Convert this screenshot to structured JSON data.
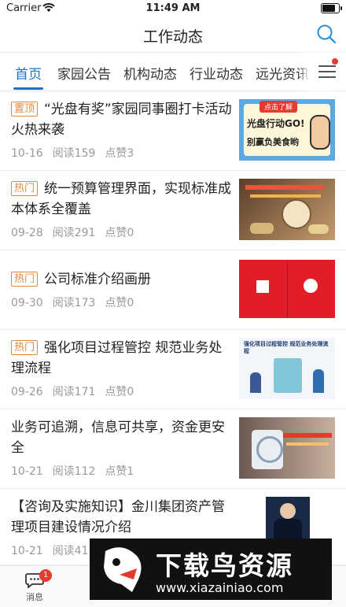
{
  "status_bar": {
    "carrier": "Carrier",
    "time": "11:49 AM",
    "battery_level": 0.9
  },
  "header": {
    "title": "工作动态"
  },
  "tabs": [
    {
      "label": "首页",
      "active": true
    },
    {
      "label": "家园公告",
      "active": false
    },
    {
      "label": "机构动态",
      "active": false
    },
    {
      "label": "行业动态",
      "active": false
    },
    {
      "label": "远光资讯",
      "active": false
    }
  ],
  "news": [
    {
      "badge": "置顶",
      "title": "“光盘有奖”家园同事圈打卡活动火热来袭",
      "date": "10-16",
      "reads": "阅读159",
      "likes": "点赞3",
      "thumb_text_1": "点击了解",
      "thumb_text_2": "光盘行动GO!",
      "thumb_text_3": "别赢负美食哟"
    },
    {
      "badge": "热门",
      "title": "统一预算管理界面，实现标准成本体系全覆盖",
      "date": "09-28",
      "reads": "阅读291",
      "likes": "点赞0"
    },
    {
      "badge": "热门",
      "title": "公司标准介绍画册",
      "date": "09-30",
      "reads": "阅读173",
      "likes": "点赞0"
    },
    {
      "badge": "热门",
      "title": "强化项目过程管控  规范业务处理流程",
      "date": "09-26",
      "reads": "阅读171",
      "likes": "点赞0",
      "thumb_text_1": "强化项目过程管控  规范业务处理流程"
    },
    {
      "badge": "",
      "title": "业务可追溯，信息可共享，资金更安全",
      "date": "10-21",
      "reads": "阅读112",
      "likes": "点赞1"
    },
    {
      "badge": "",
      "title": "【咨询及实施知识】金川集团资产管理项目建设情况介绍",
      "date": "10-21",
      "reads": "阅读41",
      "likes": ""
    }
  ],
  "tabbar": {
    "items": [
      {
        "label": "消息",
        "icon": "chat-icon",
        "badge": "1"
      }
    ]
  },
  "watermark": {
    "text": "下载鸟资源",
    "url": "www.xiazainiao.com"
  },
  "colors": {
    "accent": "#1f6fc5",
    "badge": "#e08a3c",
    "notify": "#e63a2e"
  }
}
